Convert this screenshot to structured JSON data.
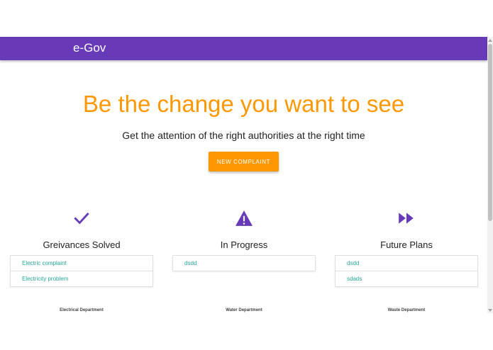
{
  "navbar": {
    "brand": "e-Gov",
    "color": "#673ab7"
  },
  "hero": {
    "title": "Be the change you want to see",
    "subtitle": "Get the attention of the right authorities at the right time",
    "button_label": "NEW COMPLAINT",
    "accent": "#ff9800"
  },
  "columns": [
    {
      "icon": "check-icon",
      "title": "Greivances Solved",
      "items": [
        "Electric complaint",
        "Electricity problem"
      ],
      "department": "Electrical Department"
    },
    {
      "icon": "warning-icon",
      "title": "In Progress",
      "items": [
        "dsdd"
      ],
      "department": "Water Department"
    },
    {
      "icon": "fast-forward-icon",
      "title": "Future Plans",
      "items": [
        "dsdd",
        "sdads"
      ],
      "department": "Waste Department"
    }
  ],
  "colors": {
    "primary": "#673ab7",
    "accent": "#ff9800",
    "link": "#26a69a"
  }
}
